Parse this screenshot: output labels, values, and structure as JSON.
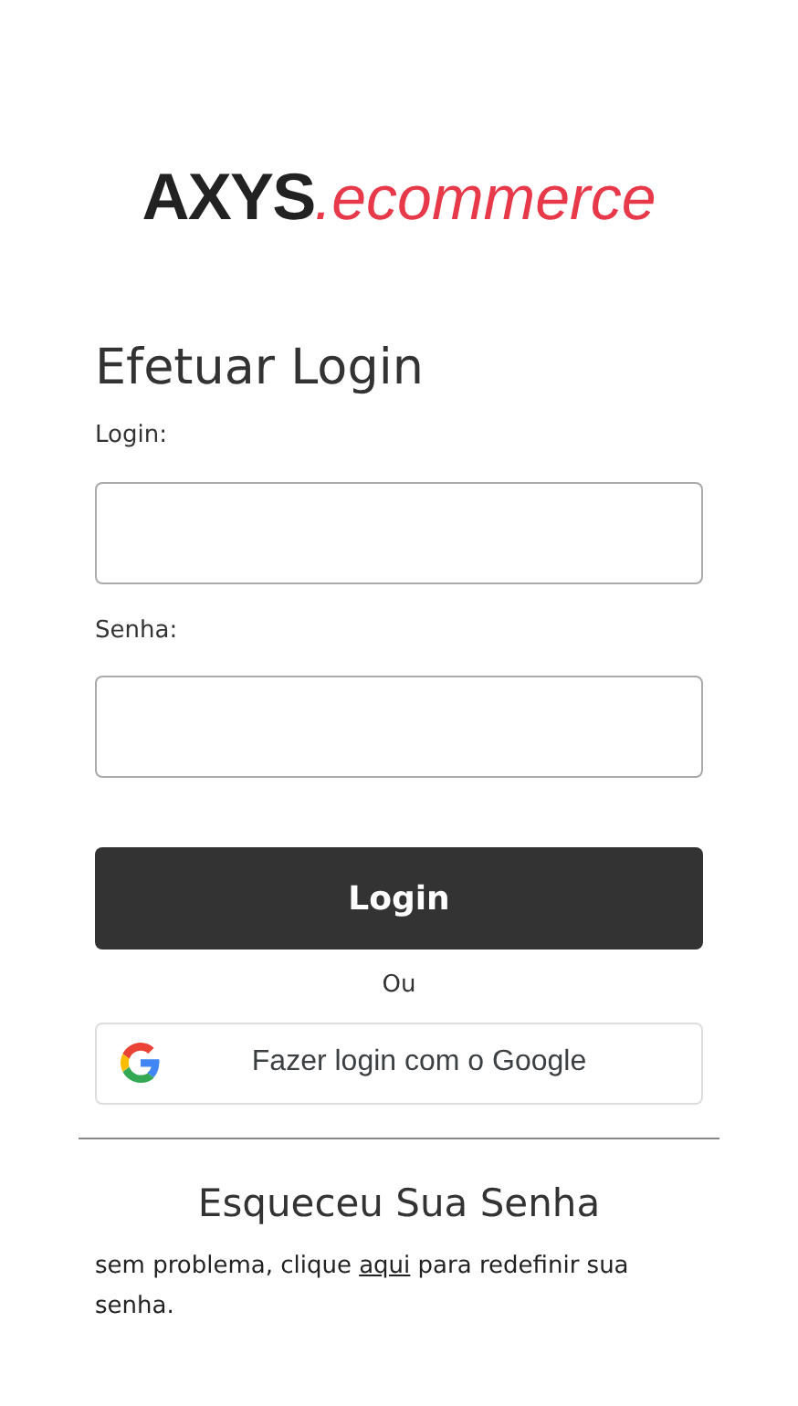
{
  "logo": {
    "brand": "AXYS",
    "suffix": ".ecommerce"
  },
  "heading": "Efetuar Login",
  "fields": [
    {
      "label": "Login:"
    },
    {
      "label": "Senha:"
    }
  ],
  "login_button": "Login",
  "separator": "Ou",
  "google_button": "Fazer login com o Google",
  "forgot": {
    "title": "Esqueceu Sua Senha",
    "before": "sem problema, clique ",
    "link": "aqui",
    "after": " para redefinir sua senha."
  }
}
